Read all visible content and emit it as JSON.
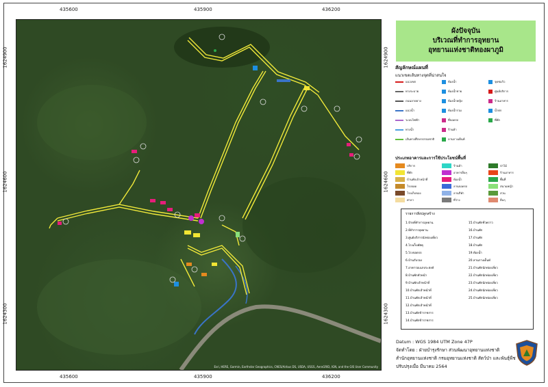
{
  "title": {
    "line1": "ผังปัจจุบัน",
    "line2": "บริเวณที่ทำการอุทยาน",
    "line3": "อุทยานแห่งชาติทองผาภูมิ"
  },
  "axes": {
    "x_ticks": [
      "435600",
      "435900",
      "436200"
    ],
    "y_ticks": [
      "1624900",
      "1624600",
      "1624300"
    ]
  },
  "attribution": "Esri, HERE, Garmin, Earthstar Geographics, CNES/Airbus DS, USDA, USGS, AeroGRID, IGN, and the GIS User Community",
  "legend": {
    "heading": "สัญลักษณ์แผนที่",
    "subheading": "แนวเขตเส้นทางจุดที่น่าสนใจ",
    "symbols": [
      {
        "label": "แนวเขต",
        "color": "#d61a1a",
        "kind": "line"
      },
      {
        "label": "ทางระบาย",
        "color": "#666666",
        "kind": "line"
      },
      {
        "label": "ถนนลาดยาง",
        "color": "#555555",
        "kind": "line"
      },
      {
        "label": "แนวน้ำ",
        "color": "#3a74c8",
        "kind": "line"
      },
      {
        "label": "ระบบไฟฟ้า",
        "color": "#aa66cc",
        "kind": "line"
      },
      {
        "label": "ทางน้ำ",
        "color": "#4aa0e0",
        "kind": "line"
      },
      {
        "label": "เส้นทางศึกษาธรรมชาติ",
        "color": "#5fbf3a",
        "kind": "line"
      },
      {
        "label": "ห้องน้ำ",
        "color": "#1d8fe0",
        "kind": "icon"
      },
      {
        "label": "ห้องน้ำชาย",
        "color": "#1d8fe0",
        "kind": "icon"
      },
      {
        "label": "ห้องน้ำหญิง",
        "color": "#1d8fe0",
        "kind": "icon"
      },
      {
        "label": "ห้องน้ำรวม",
        "color": "#1d8fe0",
        "kind": "icon"
      },
      {
        "label": "ที่จอดรถ",
        "color": "#cc2b8a",
        "kind": "icon"
      },
      {
        "label": "ร้านค้า",
        "color": "#cc2b8a",
        "kind": "icon"
      },
      {
        "label": "ลานกางเต็นท์",
        "color": "#2aa84a",
        "kind": "icon"
      },
      {
        "label": "จุดชมวิว",
        "color": "#1d8fe0",
        "kind": "icon"
      },
      {
        "label": "ศูนย์บริการ",
        "color": "#d61a1a",
        "kind": "icon"
      },
      {
        "label": "ร้านอาหาร",
        "color": "#cc2b8a",
        "kind": "icon"
      },
      {
        "label": "น้ำตก",
        "color": "#1d8fe0",
        "kind": "icon"
      },
      {
        "label": "ที่พัก",
        "color": "#2aa84a",
        "kind": "icon"
      }
    ],
    "landuse_heading": "ประเภทอาคารและการใช้ประโยชน์พื้นที่",
    "landuse": [
      {
        "label": "บริการ",
        "color": "#e58a1f"
      },
      {
        "label": "ที่พัก",
        "color": "#f2e534"
      },
      {
        "label": "บ้านพักเจ้าหน้าที่",
        "color": "#d9b24a"
      },
      {
        "label": "โรงจอด",
        "color": "#c48a2a"
      },
      {
        "label": "โรงเก็บของ",
        "color": "#7a4a2a"
      },
      {
        "label": "ศาลา",
        "color": "#f4dca0"
      },
      {
        "label": "ร้านค้า",
        "color": "#2ed6c6"
      },
      {
        "label": "อาคารอื่นๆ",
        "color": "#c02fd0"
      },
      {
        "label": "ห้องน้ำ",
        "color": "#e61d7a"
      },
      {
        "label": "ลานจอดรถ",
        "color": "#3a6ad8"
      },
      {
        "label": "ลานกีฬา",
        "color": "#8fb2e8"
      },
      {
        "label": "ที่ว่าง",
        "color": "#7a7a7a"
      },
      {
        "label": "ป่าไม้",
        "color": "#2e7a2a"
      },
      {
        "label": "ร้านอาหาร",
        "color": "#e8451a"
      },
      {
        "label": "พื้นที่",
        "color": "#2aa84a"
      },
      {
        "label": "สนามหญ้า",
        "color": "#8ae07a"
      },
      {
        "label": "สวน",
        "color": "#5a9a3a"
      },
      {
        "label": "อื่นๆ",
        "color": "#e08a70"
      }
    ]
  },
  "name_list": {
    "heading": "รายการสิ่งปลูกสร้าง",
    "left": [
      "1.ป้ายที่ทำการอุทยาน",
      "2.ที่ทำการอุทยาน",
      "3.ศูนย์บริการนักท่องเที่ยว",
      "4.โรงเก็บพัสดุ",
      "5.โรงจอดรถ",
      "6.บ้านรับรอง",
      "7.อาคารอเนกประสงค์",
      "8.บ้านพักหัวหน้า",
      "9.บ้านพักเจ้าหน้าที่",
      "10.บ้านพักเจ้าหน้าที่",
      "11.บ้านพักเจ้าหน้าที่",
      "12.บ้านพักเจ้าหน้าที่",
      "13.บ้านพักข้าราชการ",
      "14.บ้านพักข้าราชการ"
    ],
    "right": [
      "15.บ้านพักชั่วคราว",
      "16.บ้านพัก",
      "17.บ้านพัก",
      "18.บ้านพัก",
      "19.ห้องน้ำ",
      "20.ลานกางเต็นท์",
      "21.บ้านพักนักท่องเที่ยว",
      "22.บ้านพักนักท่องเที่ยว",
      "23.บ้านพักนักท่องเที่ยว",
      "24.บ้านพักนักท่องเที่ยว",
      "25.บ้านพักนักท่องเที่ยว"
    ]
  },
  "footer": {
    "datum": "Datum : WGS 1984 UTM Zone 47P",
    "made_by": "จัดทำโดย : ฝ่ายบำรุงรักษา ส่วนพัฒนาอุทยานแห่งชาติ",
    "org": "สำนักอุทยานแห่งชาติ กรมอุทยานแห่งชาติ สัตว์ป่า และพันธุ์พืช",
    "updated": "ปรับปรุงเมื่อ มีนาคม 2564"
  },
  "colors": {
    "road": "#f2ea3a",
    "stream": "#3a74c8",
    "title_bg": "#a8e68a"
  }
}
